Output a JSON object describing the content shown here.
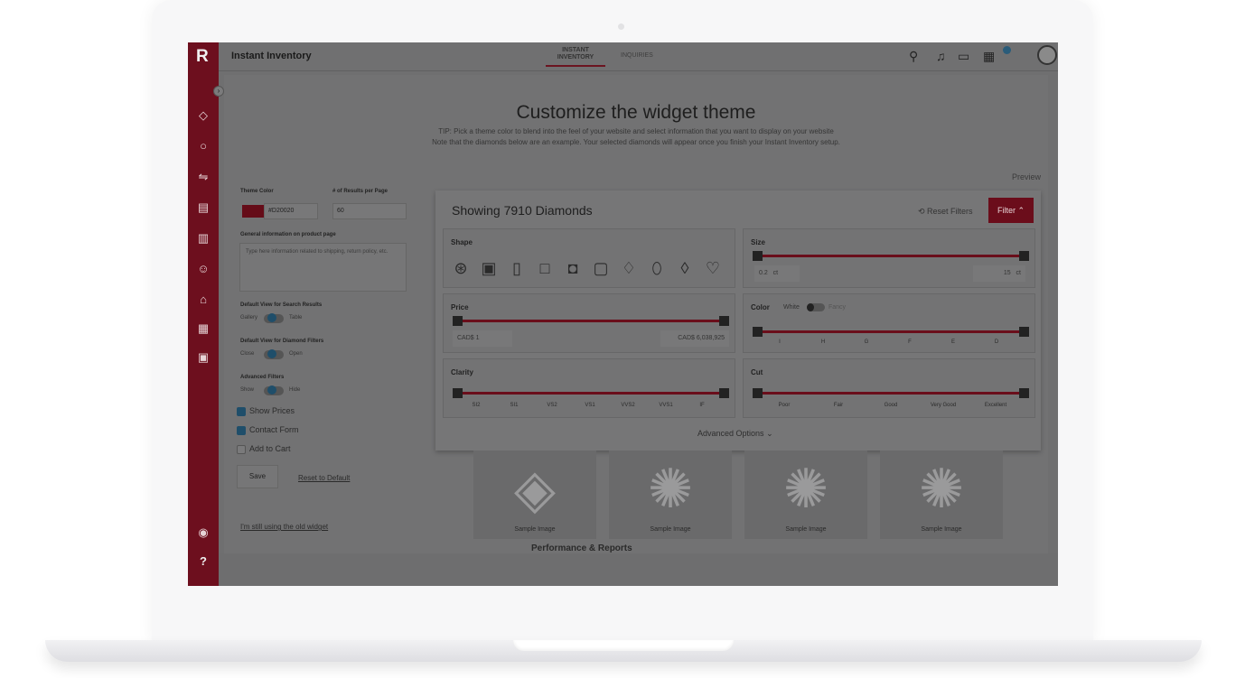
{
  "app": {
    "logo": "R",
    "title": "Instant Inventory"
  },
  "tabs": [
    {
      "label": "INSTANT INVENTORY"
    },
    {
      "label": "INQUIRIES"
    }
  ],
  "heading": "Customize the widget theme",
  "tip_lines": [
    "TIP: Pick a theme color to blend into the feel of your website and select information that you want to display on your website",
    "Note that the diamonds below are an example. Your selected diamonds will appear once you finish your Instant Inventory setup."
  ],
  "preview_label": "Preview",
  "settings": {
    "theme_color_label": "Theme Color",
    "theme_color_value": "#D20020",
    "results_label": "# of Results per Page",
    "results_value": "60",
    "general_info_label": "General information on product page",
    "general_info_placeholder": "Type here information related to shipping, return policy, etc.",
    "default_view_label": "Default View for Search Results",
    "default_view_options": [
      "Gallery",
      "Table"
    ],
    "filters_view_label": "Default View for Diamond Filters",
    "filters_view_options": [
      "Close",
      "Open"
    ],
    "advanced_label": "Advanced Filters",
    "advanced_options": [
      "Show",
      "Hide"
    ],
    "show_prices": "Show Prices",
    "contact_form": "Contact Form",
    "add_to_cart": "Add to Cart",
    "save": "Save",
    "reset": "Reset to Default",
    "old_widget": "I'm still using the old widget"
  },
  "preview": {
    "showing": "Showing 7910 Diamonds",
    "reset_filters": "Reset Filters",
    "filter_btn": "Filter",
    "shape_label": "Shape",
    "size_label": "Size",
    "size_min": "0.2",
    "size_max": "15",
    "size_unit": "ct",
    "price_label": "Price",
    "price_min": "CAD$ 1",
    "price_max": "CAD$ 6,038,925",
    "color_label": "Color",
    "color_white": "White",
    "color_fancy": "Fancy",
    "color_grades": [
      "I",
      "H",
      "G",
      "F",
      "E",
      "D"
    ],
    "clarity_label": "Clarity",
    "clarity_grades": [
      "SI2",
      "SI1",
      "VS2",
      "VS1",
      "VVS2",
      "VVS1",
      "IF"
    ],
    "cut_label": "Cut",
    "cut_grades": [
      "Poor",
      "Fair",
      "Good",
      "Very Good",
      "Excellent"
    ],
    "advanced_options": "Advanced Options",
    "sample_label": "Sample Image"
  },
  "footer_heading": "Performance & Reports",
  "colors": {
    "brand": "#D20020",
    "accent": "#2E86C1"
  }
}
